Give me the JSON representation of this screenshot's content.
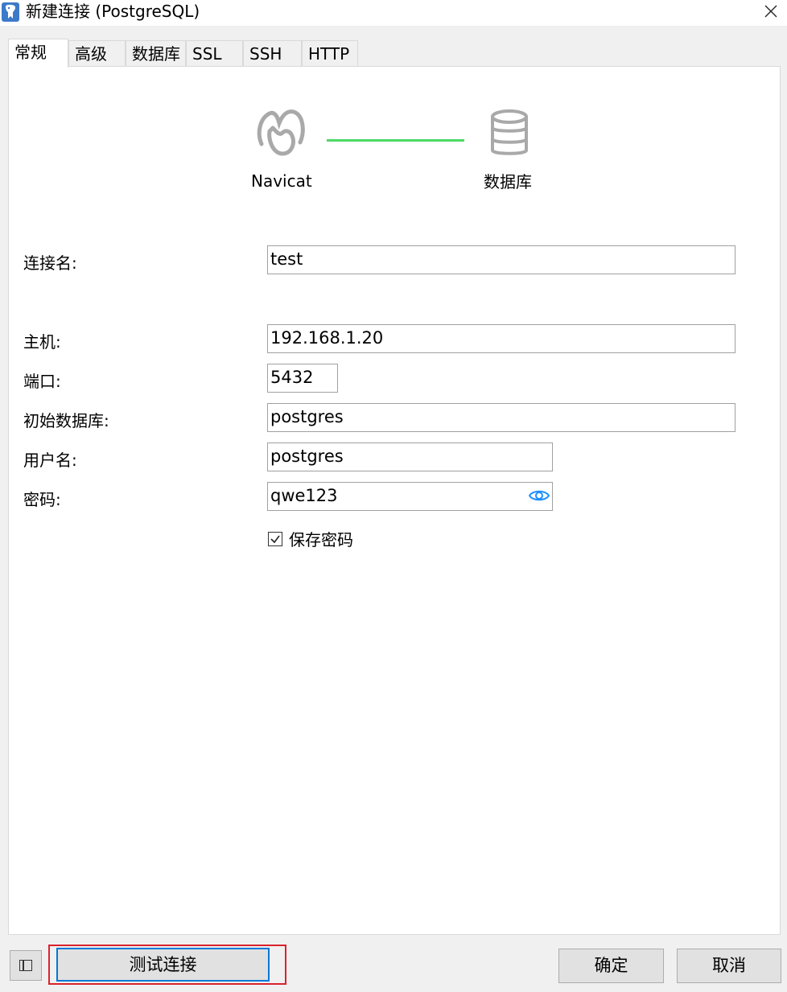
{
  "window": {
    "title": "新建连接 (PostgreSQL)"
  },
  "tabs": [
    {
      "label": "常规",
      "active": true
    },
    {
      "label": "高级",
      "active": false
    },
    {
      "label": "数据库",
      "active": false
    },
    {
      "label": "SSL",
      "active": false
    },
    {
      "label": "SSH",
      "active": false
    },
    {
      "label": "HTTP",
      "active": false
    }
  ],
  "graphic": {
    "left_label": "Navicat",
    "right_label": "数据库",
    "left_icon": "navicat-logo-icon",
    "right_icon": "database-icon",
    "line_color": "#4cd964"
  },
  "form": {
    "connection_name": {
      "label": "连接名:",
      "value": "test"
    },
    "host": {
      "label": "主机:",
      "value": "192.168.1.20"
    },
    "port": {
      "label": "端口:",
      "value": "5432"
    },
    "initial_database": {
      "label": "初始数据库:",
      "value": "postgres"
    },
    "username": {
      "label": "用户名:",
      "value": "postgres"
    },
    "password": {
      "label": "密码:",
      "value": "qwe123",
      "reveal_icon": "eye-icon"
    },
    "save_password": {
      "label": "保存密码",
      "checked": true
    }
  },
  "footer": {
    "test_connection": "测试连接",
    "ok": "确定",
    "cancel": "取消"
  },
  "colors": {
    "accent": "#0078d7",
    "highlight_box": "#d9232d",
    "eye_icon": "#1e90ff"
  }
}
